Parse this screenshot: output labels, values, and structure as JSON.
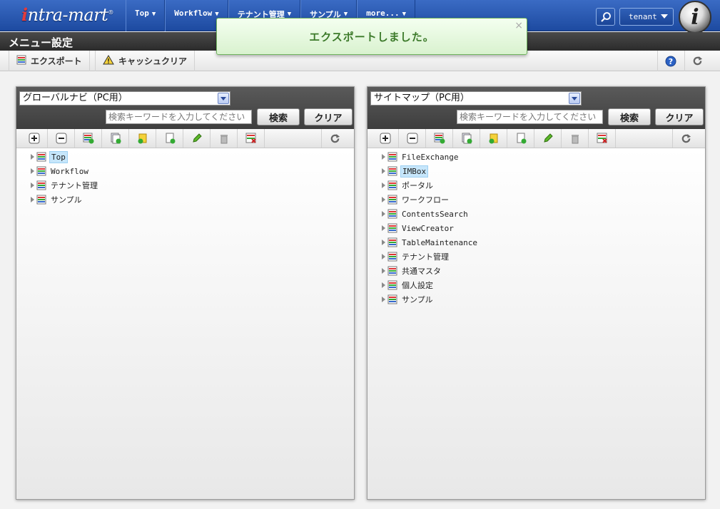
{
  "header": {
    "logo": "intra-mart",
    "nav": [
      {
        "label": "Top"
      },
      {
        "label": "Workflow"
      },
      {
        "label": "テナント管理"
      },
      {
        "label": "サンプル"
      },
      {
        "label": "more..."
      }
    ],
    "tenant": "tenant"
  },
  "page": {
    "title": "メニュー設定"
  },
  "toolbar": {
    "export_label": "エクスポート",
    "cache_clear_label": "キャッシュクリア"
  },
  "notification": {
    "message": "エクスポートしました。",
    "close": "×"
  },
  "left_panel": {
    "select": "グローバルナビ（PC用）",
    "search_placeholder": "検索キーワードを入力してください",
    "search_button": "検索",
    "clear_button": "クリア",
    "tree": [
      {
        "label": "Top",
        "selected": true
      },
      {
        "label": "Workflow"
      },
      {
        "label": "テナント管理"
      },
      {
        "label": "サンプル"
      }
    ]
  },
  "right_panel": {
    "select": "サイトマップ（PC用）",
    "search_placeholder": "検索キーワードを入力してください",
    "search_button": "検索",
    "clear_button": "クリア",
    "tree": [
      {
        "label": "FileExchange"
      },
      {
        "label": "IMBox",
        "selected": true
      },
      {
        "label": "ポータル"
      },
      {
        "label": "ワークフロー"
      },
      {
        "label": "ContentsSearch"
      },
      {
        "label": "ViewCreator"
      },
      {
        "label": "TableMaintenance"
      },
      {
        "label": "テナント管理"
      },
      {
        "label": "共通マスタ"
      },
      {
        "label": "個人設定"
      },
      {
        "label": "サンプル"
      }
    ]
  }
}
